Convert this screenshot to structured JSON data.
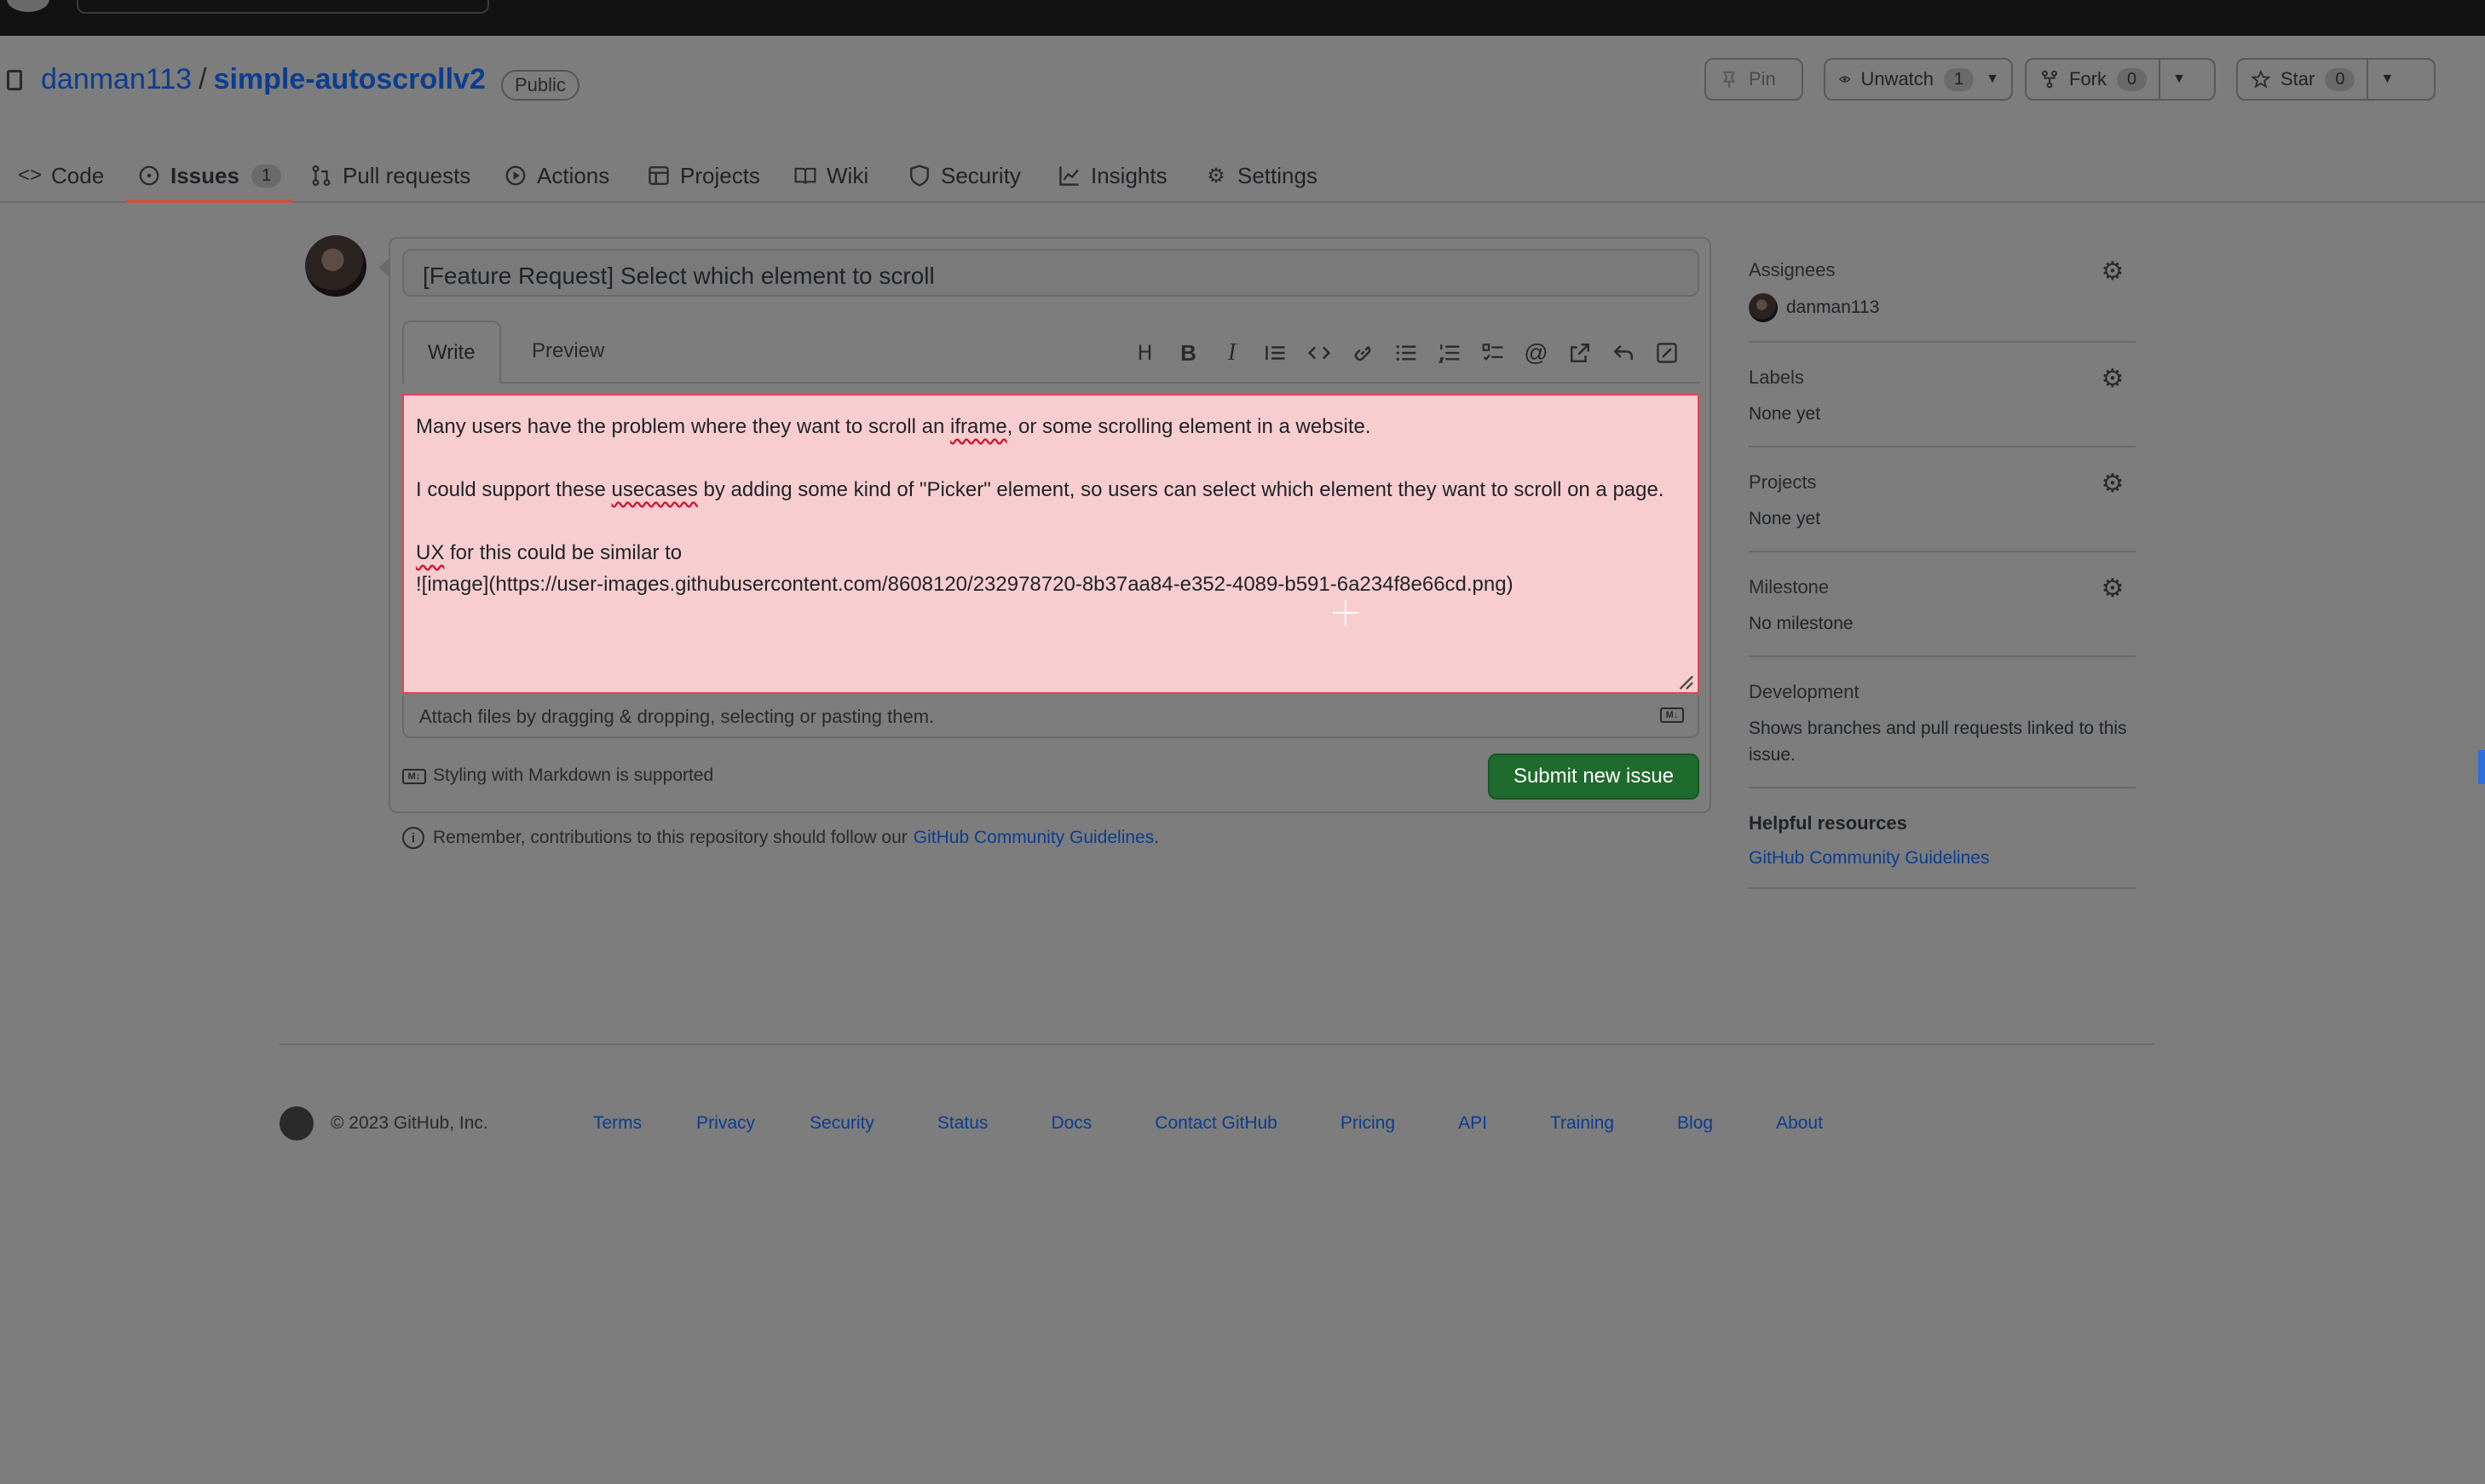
{
  "repo": {
    "owner": "danman113",
    "separator": "/",
    "name": "simple-autoscrollv2",
    "visibility": "Public"
  },
  "header_buttons": {
    "pin": "Pin",
    "unwatch": "Unwatch",
    "unwatch_count": "1",
    "fork": "Fork",
    "fork_count": "0",
    "star": "Star",
    "star_count": "0"
  },
  "tabs": [
    {
      "label": "Code",
      "icon": "code-icon"
    },
    {
      "label": "Issues",
      "icon": "issue-icon",
      "count": "1",
      "active": true
    },
    {
      "label": "Pull requests",
      "icon": "pull-request-icon"
    },
    {
      "label": "Actions",
      "icon": "play-icon"
    },
    {
      "label": "Projects",
      "icon": "table-icon"
    },
    {
      "label": "Wiki",
      "icon": "book-icon"
    },
    {
      "label": "Security",
      "icon": "shield-icon"
    },
    {
      "label": "Insights",
      "icon": "graph-icon"
    },
    {
      "label": "Settings",
      "icon": "gear-icon"
    }
  ],
  "issue_form": {
    "title_value": "[Feature Request] Select which element to scroll",
    "write_tab": "Write",
    "preview_tab": "Preview",
    "body": {
      "line1_a": "Many users have the problem where they want to scroll an ",
      "line1_b": "iframe",
      "line1_c": ", or some scrolling element in a website.",
      "line2_a": "I could support these ",
      "line2_b": "usecases",
      "line2_c": " by adding some kind of \"Picker\" element, so users can select which element they want to scroll on a page.",
      "line3_a": "UX",
      "line3_b": " for this could be similar to",
      "line4": "![image](https://user-images.githubusercontent.com/8608120/232978720-8b37aa84-e352-4089-b591-6a234f8e66cd.png)"
    },
    "attach_text": "Attach files by dragging & dropping, selecting or pasting them.",
    "markdown_note": "Styling with Markdown is supported",
    "submit_label": "Submit new issue",
    "remember_text": "Remember, contributions to this repository should follow our",
    "remember_link": "GitHub Community Guidelines",
    "remember_end": "."
  },
  "sidebar": {
    "assignees": {
      "title": "Assignees",
      "user": "danman113"
    },
    "labels": {
      "title": "Labels",
      "value": "None yet"
    },
    "projects": {
      "title": "Projects",
      "value": "None yet"
    },
    "milestone": {
      "title": "Milestone",
      "value": "No milestone"
    },
    "development": {
      "title": "Development",
      "value": "Shows branches and pull requests linked to this issue."
    },
    "helpful": {
      "title": "Helpful resources",
      "link": "GitHub Community Guidelines"
    }
  },
  "footer": {
    "copyright": "© 2023 GitHub, Inc.",
    "links": [
      "Terms",
      "Privacy",
      "Security",
      "Status",
      "Docs",
      "Contact GitHub",
      "Pricing",
      "API",
      "Training",
      "Blog",
      "About"
    ]
  }
}
